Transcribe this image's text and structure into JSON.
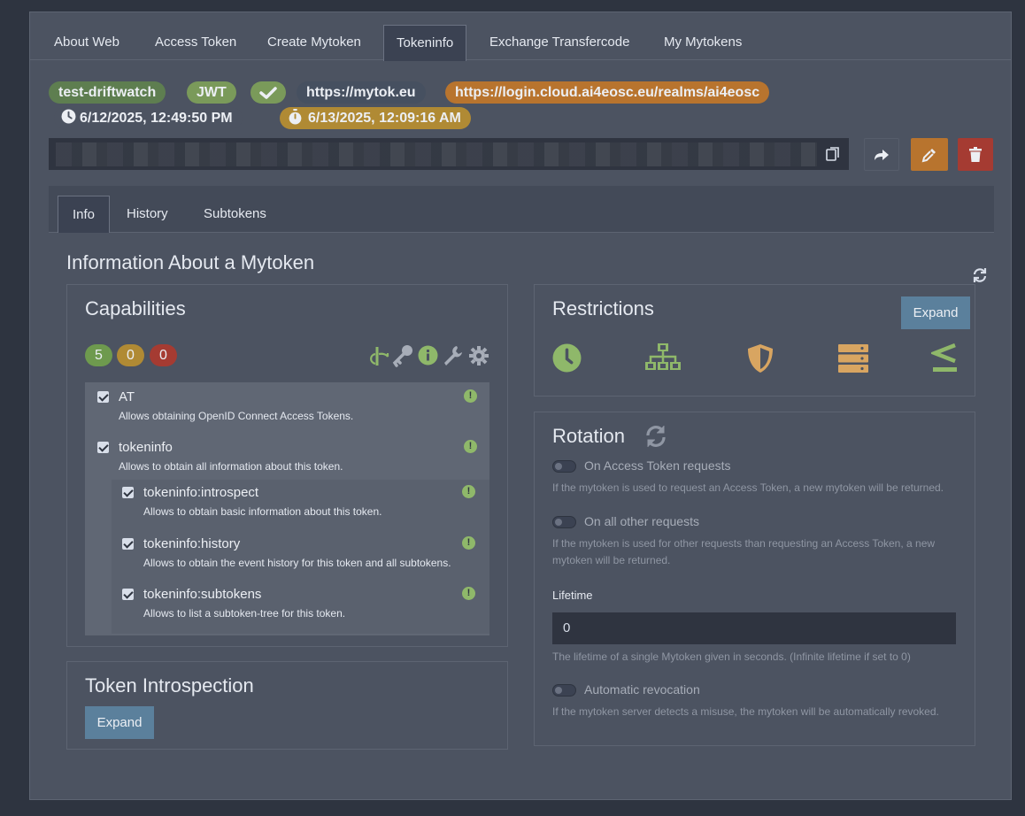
{
  "nav": {
    "tabs": [
      "About Web",
      "Access Token",
      "Create Mytoken",
      "Tokeninfo",
      "Exchange Transfercode",
      "My Mytokens"
    ]
  },
  "token": {
    "name": "test-driftwatch",
    "type": "JWT",
    "issuer": "https://mytok.eu",
    "oidc_issuer": "https://login.cloud.ai4eosc.eu/realms/ai4eosc",
    "created": "6/12/2025, 12:49:50 PM",
    "expires": "6/13/2025, 12:09:16 AM"
  },
  "subtabs": [
    "Info",
    "History",
    "Subtokens"
  ],
  "page_title": "Information About a Mytoken",
  "capabilities": {
    "title": "Capabilities",
    "counts": {
      "green": "5",
      "yellow": "0",
      "red": "0"
    },
    "items": [
      {
        "name": "AT",
        "desc": "Allows obtaining OpenID Connect Access Tokens."
      },
      {
        "name": "tokeninfo",
        "desc": "Allows to obtain all information about this token."
      },
      {
        "name": "tokeninfo:introspect",
        "desc": "Allows to obtain basic information about this token."
      },
      {
        "name": "tokeninfo:history",
        "desc": "Allows to obtain the event history for this token and all subtokens."
      },
      {
        "name": "tokeninfo:subtokens",
        "desc": "Allows to list a subtoken-tree for this token."
      }
    ]
  },
  "introspection": {
    "title": "Token Introspection",
    "expand": "Expand"
  },
  "restrictions": {
    "title": "Restrictions",
    "expand": "Expand"
  },
  "rotation": {
    "title": "Rotation",
    "at_label": "On Access Token requests",
    "at_help": "If the mytoken is used to request an Access Token, a new mytoken will be returned.",
    "other_label": "On all other requests",
    "other_help": "If the mytoken is used for other requests than requesting an Access Token, a new mytoken will be returned.",
    "lifetime_label": "Lifetime",
    "lifetime_value": "0",
    "lifetime_help": "The lifetime of a single Mytoken given in seconds. (Infinite lifetime if set to 0)",
    "revoke_label": "Automatic revocation",
    "revoke_help": "If the mytoken server detects a misuse, the mytoken will be automatically revoked."
  },
  "colors": {
    "green": "#8fb86a",
    "orange": "#b8742e",
    "red": "#a53b32",
    "blue": "#5b809c",
    "shield": "#d8a561"
  }
}
